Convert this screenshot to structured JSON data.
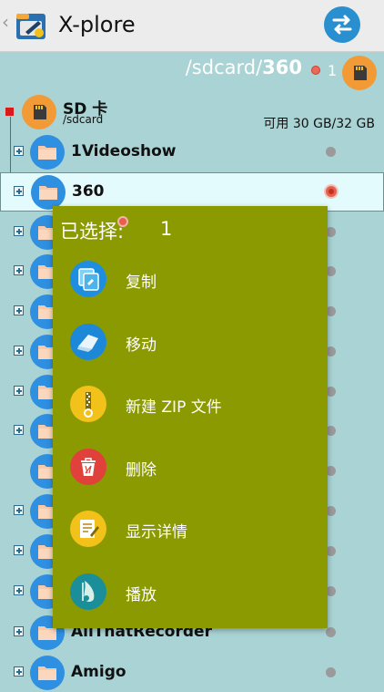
{
  "app": {
    "title": "X-plore"
  },
  "path": {
    "prefix": "/sdcard/",
    "current": "360",
    "selected_count": "1"
  },
  "sd": {
    "name": "SD 卡",
    "path": "/sdcard",
    "free": "可用 30 GB/32 GB"
  },
  "folders": [
    {
      "name": "1Videoshow"
    },
    {
      "name": "360"
    },
    {
      "name": ""
    },
    {
      "name": ""
    },
    {
      "name": ""
    },
    {
      "name": ""
    },
    {
      "name": ""
    },
    {
      "name": ""
    },
    {
      "name": ""
    },
    {
      "name": ""
    },
    {
      "name": ""
    },
    {
      "name": "AllThatRecorder"
    },
    {
      "name": "Amigo"
    }
  ],
  "menu": {
    "title": "已选择:",
    "count": "1",
    "items": [
      {
        "label": "复制",
        "icon": "copy-icon",
        "color": "#1e8fe0"
      },
      {
        "label": "移动",
        "icon": "move-icon",
        "color": "#1e88d8"
      },
      {
        "label": "新建 ZIP 文件",
        "icon": "zip-icon",
        "color": "#f2c21a"
      },
      {
        "label": "删除",
        "icon": "delete-icon",
        "color": "#e0413a"
      },
      {
        "label": "显示详情",
        "icon": "details-icon",
        "color": "#f2c21a"
      },
      {
        "label": "播放",
        "icon": "play-icon",
        "color": "#1a8f9a"
      }
    ]
  },
  "colors": {
    "menu_bg": "#8b9a00",
    "folder_icon": "#2f8fe0",
    "sd_icon": "#f29a36",
    "list_bg": "#a9d3d4"
  }
}
